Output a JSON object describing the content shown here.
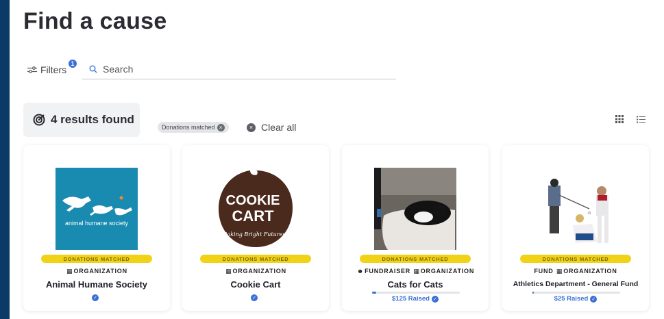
{
  "page": {
    "title": "Find a cause"
  },
  "toolbar": {
    "filters_label": "Filters",
    "filters_count": "1",
    "search_placeholder": "Search"
  },
  "results": {
    "label": "4 results found",
    "active_filter_chip": "Donations matched",
    "clear_all_label": "Clear all"
  },
  "colors": {
    "brand_blue": "#3a6fd8",
    "frame_navy": "#0b3a66",
    "badge_yellow": "#f2d216"
  },
  "cards": [
    {
      "badge": "DONATIONS MATCHED",
      "type_label": "ORGANIZATION",
      "name": "Animal Humane Society",
      "image_text": "animal humane society"
    },
    {
      "badge": "DONATIONS MATCHED",
      "type_label": "ORGANIZATION",
      "name": "Cookie Cart",
      "image_text_top": "COOKIE",
      "image_text_mid": "CART",
      "image_text_script": "Baking Bright Futures"
    },
    {
      "badge": "DONATIONS MATCHED",
      "type_label_a": "FUNDRAISER",
      "type_label_b": "ORGANIZATION",
      "name": "Cats for Cats",
      "raised": "$125 Raised",
      "progress": 0.05
    },
    {
      "badge": "DONATIONS MATCHED",
      "type_label_a": "FUND",
      "type_label_b": "ORGANIZATION",
      "name": "Athletics Department - General Fund",
      "raised": "$25 Raised",
      "progress": 0.01
    }
  ]
}
